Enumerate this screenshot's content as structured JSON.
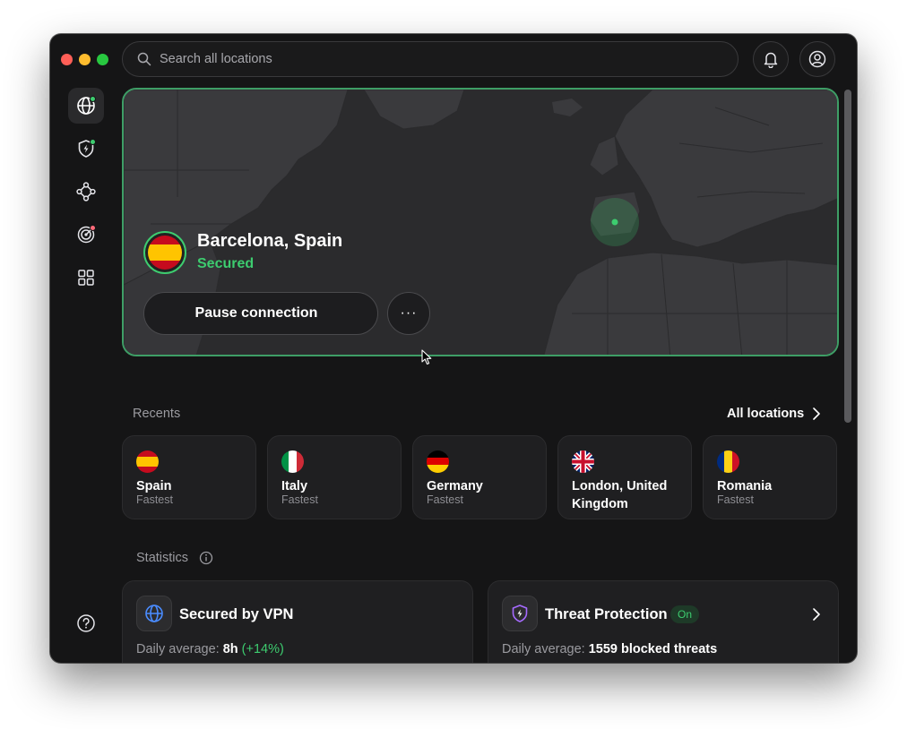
{
  "search": {
    "placeholder": "Search all locations"
  },
  "connection": {
    "location": "Barcelona, Spain",
    "status": "Secured",
    "pause_label": "Pause connection",
    "more_label": "···"
  },
  "recents": {
    "title": "Recents",
    "all_locations_label": "All locations",
    "items": [
      {
        "name": "Spain",
        "sub": "Fastest",
        "flag": "spain-flag-icon"
      },
      {
        "name": "Italy",
        "sub": "Fastest",
        "flag": "italy-flag-icon"
      },
      {
        "name": "Germany",
        "sub": "Fastest",
        "flag": "germany-flag-icon"
      },
      {
        "name": "London, United Kingdom",
        "sub": "",
        "flag": "uk-flag-icon"
      },
      {
        "name": "Romania",
        "sub": "Fastest",
        "flag": "romania-flag-icon"
      }
    ]
  },
  "statistics": {
    "title": "Statistics",
    "vpn": {
      "title": "Secured by VPN",
      "avg_label": "Daily average:",
      "avg_value": "8h",
      "change": "(+14%)"
    },
    "threat": {
      "title": "Threat Protection",
      "badge": "On",
      "avg_label": "Daily average:",
      "avg_value": "1559 blocked threats"
    }
  },
  "colors": {
    "accent": "#3dcc6f",
    "background": "#151516",
    "card": "#1f1f21"
  }
}
